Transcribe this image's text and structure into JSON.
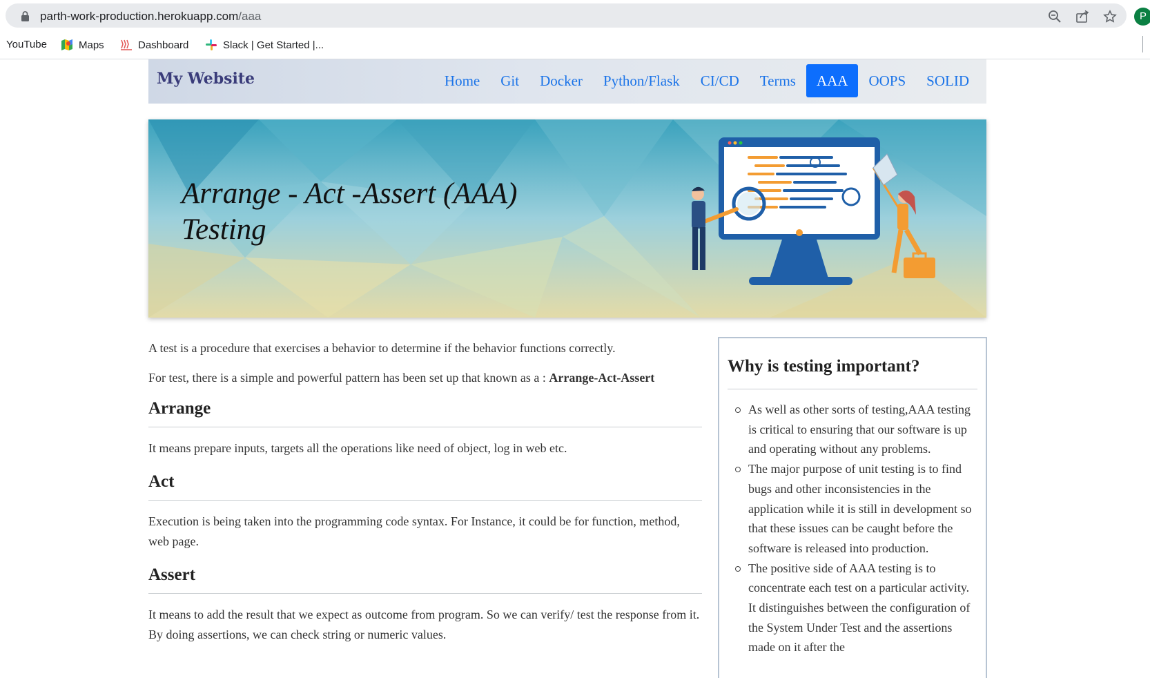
{
  "browser": {
    "url_host": "parth-work-production.herokuapp.com",
    "url_path": "/aaa",
    "profile_initial": "P",
    "icons": [
      "lock-icon",
      "zoom-icon",
      "share-icon",
      "star-icon"
    ],
    "bookmarks": [
      {
        "label": "YouTube",
        "icon": "youtube-icon"
      },
      {
        "label": "Maps",
        "icon": "maps-icon"
      },
      {
        "label": "Dashboard",
        "icon": "dashboard-icon"
      },
      {
        "label": "Slack | Get Started |...",
        "icon": "slack-icon"
      }
    ]
  },
  "navbar": {
    "brand": "My Website",
    "links": [
      "Home",
      "Git",
      "Docker",
      "Python/Flask",
      "CI/CD",
      "Terms",
      "AAA",
      "OOPS",
      "SOLID"
    ],
    "active": "AAA",
    "active_color": "#0d6efd",
    "link_color": "#1a73e8"
  },
  "hero": {
    "title_line1": "Arrange - Act -Assert (AAA)",
    "title_line2": "Testing"
  },
  "main": {
    "intro": "A test is a procedure that exercises a behavior to determine if the behavior functions correctly.",
    "pattern_text": "For test, there is a simple and powerful pattern has been set up that known as a : ",
    "pattern_name": "Arrange-Act-Assert",
    "sections": [
      {
        "heading": "Arrange",
        "text": "It means prepare inputs, targets all the operations like need of object, log in web etc."
      },
      {
        "heading": "Act",
        "text": "Execution is being taken into the programming code syntax. For Instance, it could be for function, method, web page."
      },
      {
        "heading": "Assert",
        "text": "It means to add the result that we expect as outcome from program. So we can verify/ test the response from it. By doing assertions, we can check string or numeric values."
      }
    ]
  },
  "sidebar": {
    "title": "Why is testing important?",
    "items": [
      "As well as other sorts of testing,AAA testing is critical to ensuring that our software is up and operating without any problems.",
      "The major purpose of unit testing is to find bugs and other inconsistencies in the application while it is still in development so that these issues can be caught before the software is released into production.",
      "The positive side of AAA testing is to concentrate each test on a particular activity. It distinguishes between the configuration of the System Under Test and the assertions made on it after the"
    ]
  }
}
